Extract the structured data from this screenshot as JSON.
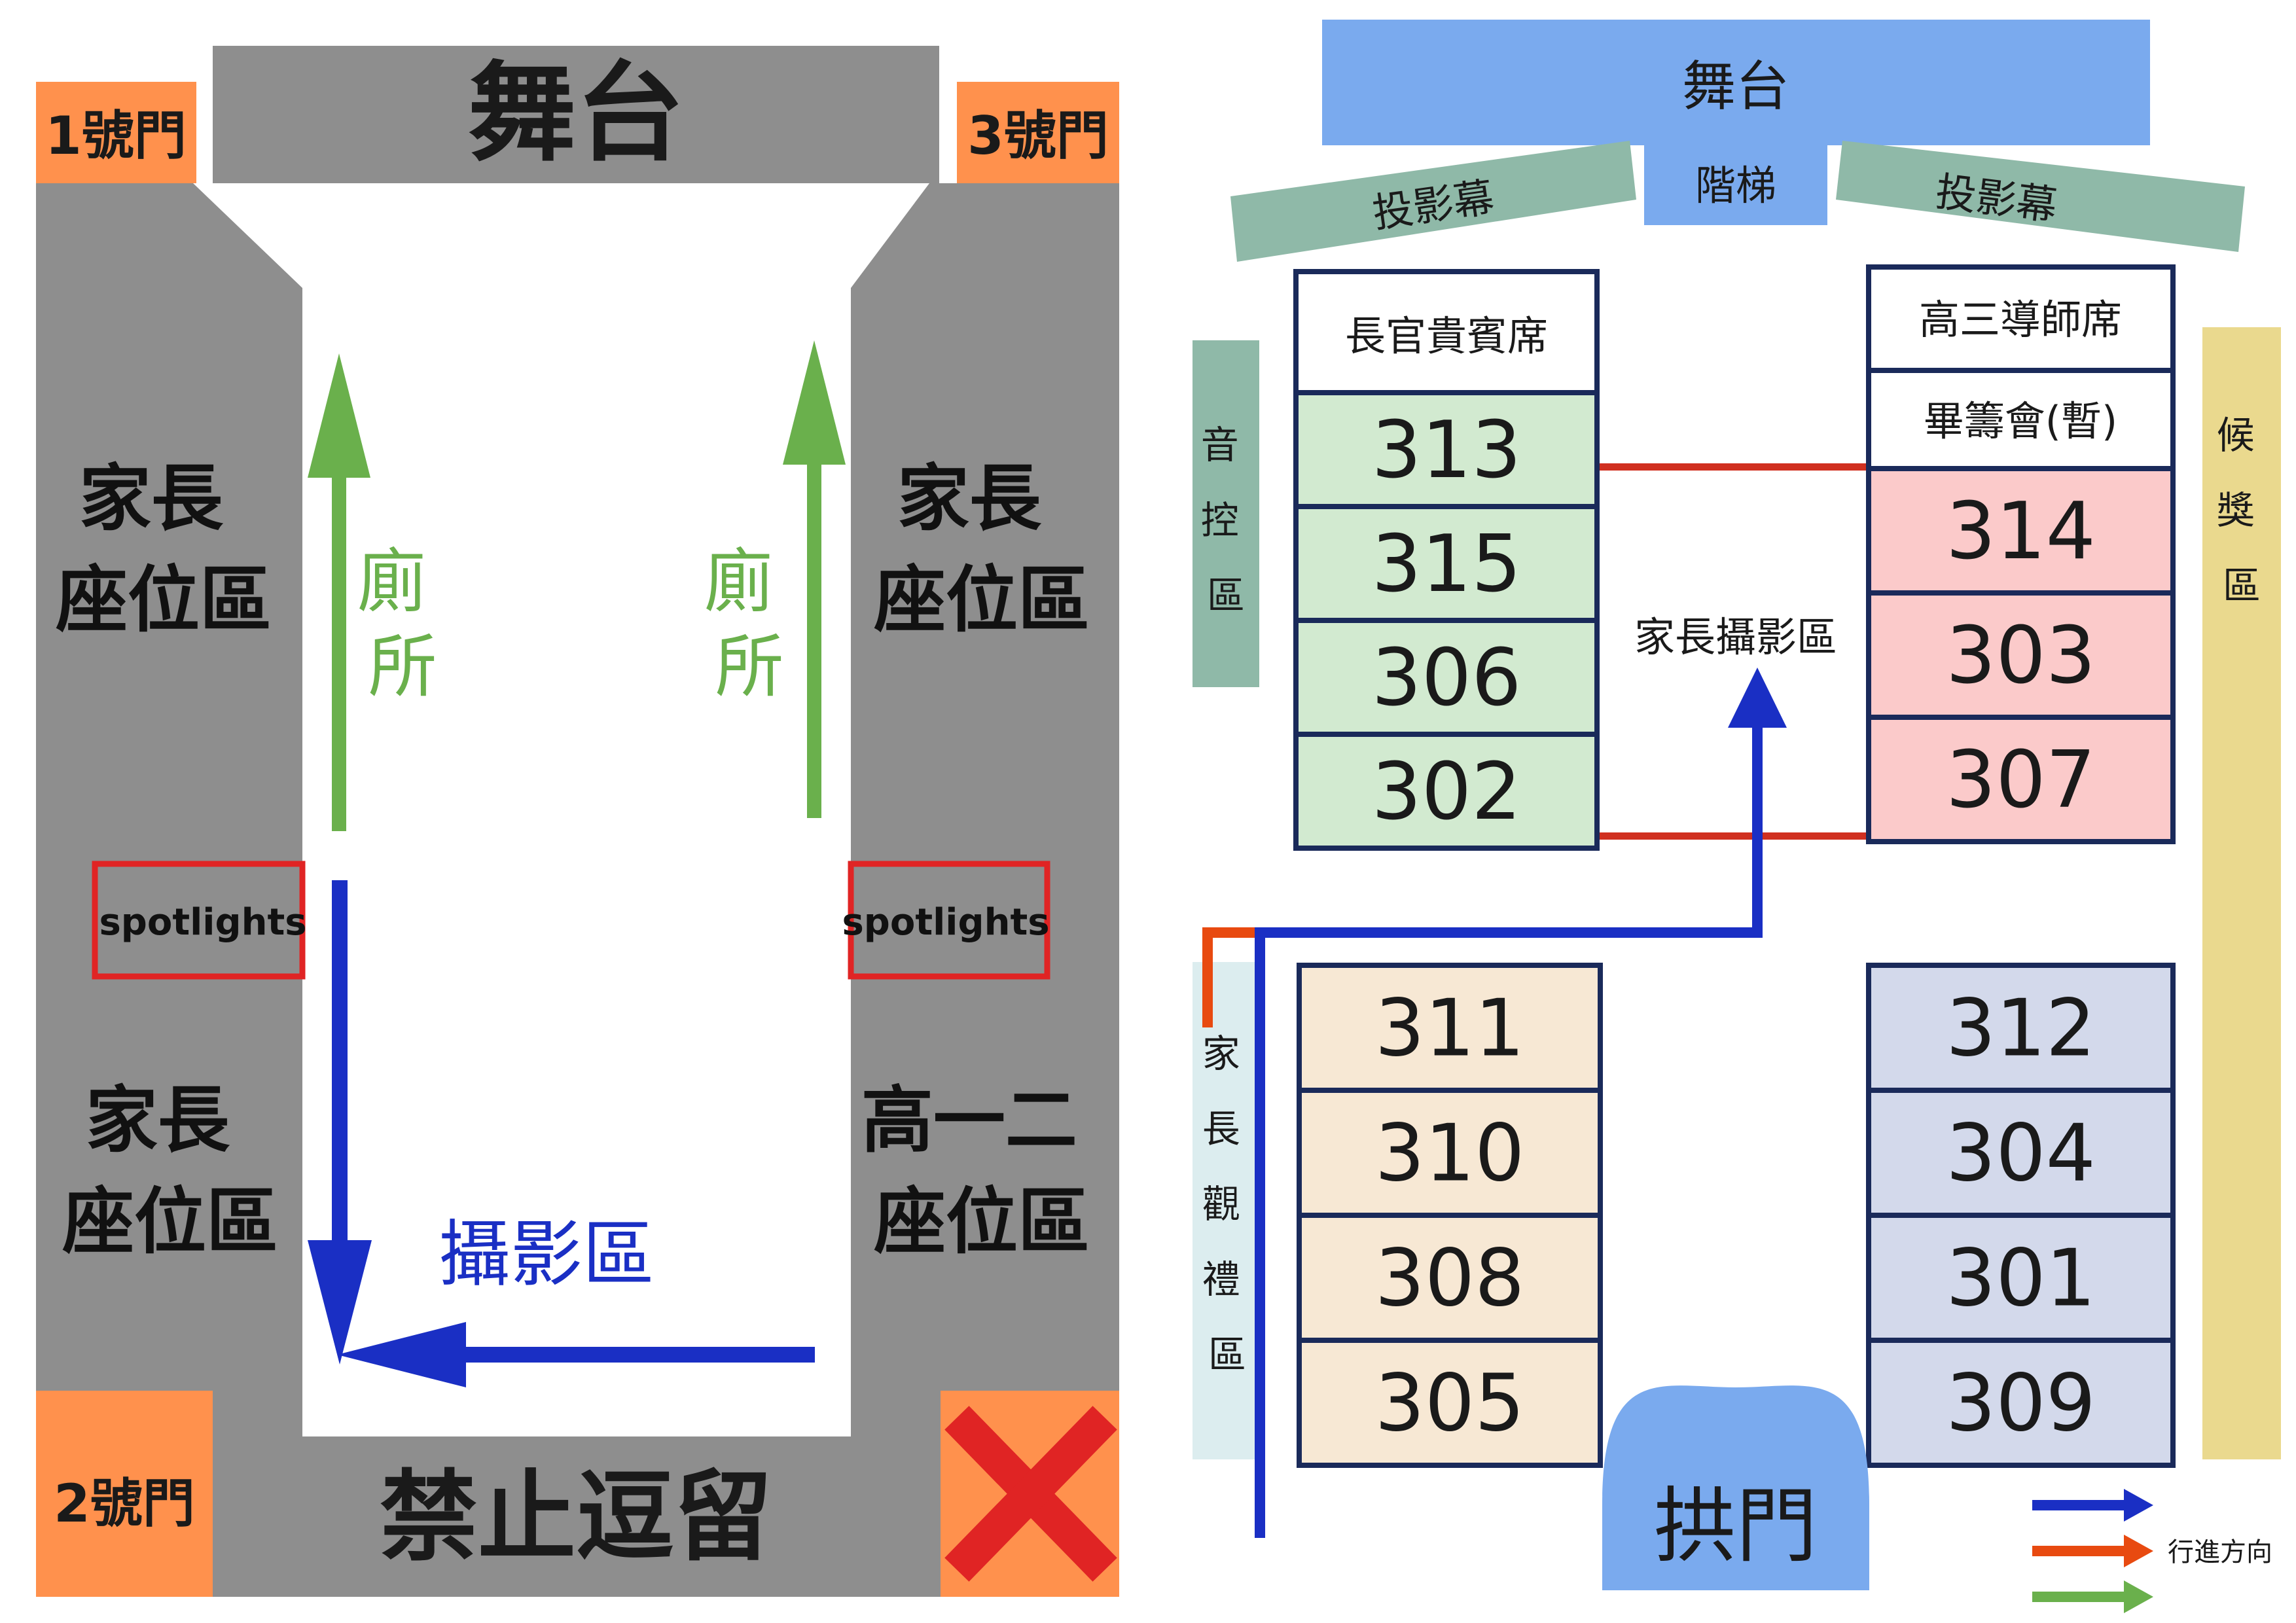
{
  "left_plan": {
    "stage": "舞台",
    "door1": "1號門",
    "door2": "2號門",
    "door3": "3號門",
    "parents_left_top": [
      "家長",
      "座位區"
    ],
    "parents_left_bottom": [
      "家長",
      "座位區"
    ],
    "parents_right_top": [
      "家長",
      "座位區"
    ],
    "grade12_right_bottom": [
      "高一二",
      "座位區"
    ],
    "toilet_left": [
      "廁",
      "所"
    ],
    "toilet_right": [
      "廁",
      "所"
    ],
    "spotlight_left": "spotlights",
    "spotlight_right": "spotlights",
    "photo_zone": "攝影區",
    "no_loitering": "禁止逗留",
    "colors": {
      "gray": "#8e8e8e",
      "orange": "#ff914d",
      "green": "#6ab04c",
      "blue": "#1a2fc4",
      "red": "#e02424"
    }
  },
  "right_plan": {
    "stage": "舞台",
    "steps": "階梯",
    "screen_left": "投影幕",
    "screen_right": "投影幕",
    "sound_control": [
      "音",
      "控",
      "區"
    ],
    "awards_waiting": [
      "候",
      "獎",
      "區"
    ],
    "parent_ceremony": [
      "家",
      "長",
      "觀",
      "禮",
      "區"
    ],
    "parent_photo_zone": "家長攝影區",
    "arch_gate": "拱門",
    "vip_header": "長官貴賓席",
    "senior_teacher_header": "高三導師席",
    "graduation_committee_header": "畢籌會(暫)",
    "green_block": [
      "313",
      "315",
      "306",
      "302"
    ],
    "pink_block": [
      "314",
      "303",
      "307"
    ],
    "beige_block": [
      "311",
      "310",
      "308",
      "305"
    ],
    "lavender_block": [
      "312",
      "304",
      "301",
      "309"
    ],
    "legend_label": "行進方向",
    "colors": {
      "stage_blue": "#7aaaee",
      "screen_green": "#8fb9a8",
      "yellow": "#ead98e",
      "light_green": "#d2ead0",
      "pink": "#fbcaca",
      "beige": "#f7e8d4",
      "lavender": "#d3d9eb",
      "light_cyan": "#dcedef",
      "navy": "#1a2a5a",
      "blue": "#1a2fc4",
      "red_orange": "#e84a10",
      "green": "#6ab04c"
    }
  }
}
